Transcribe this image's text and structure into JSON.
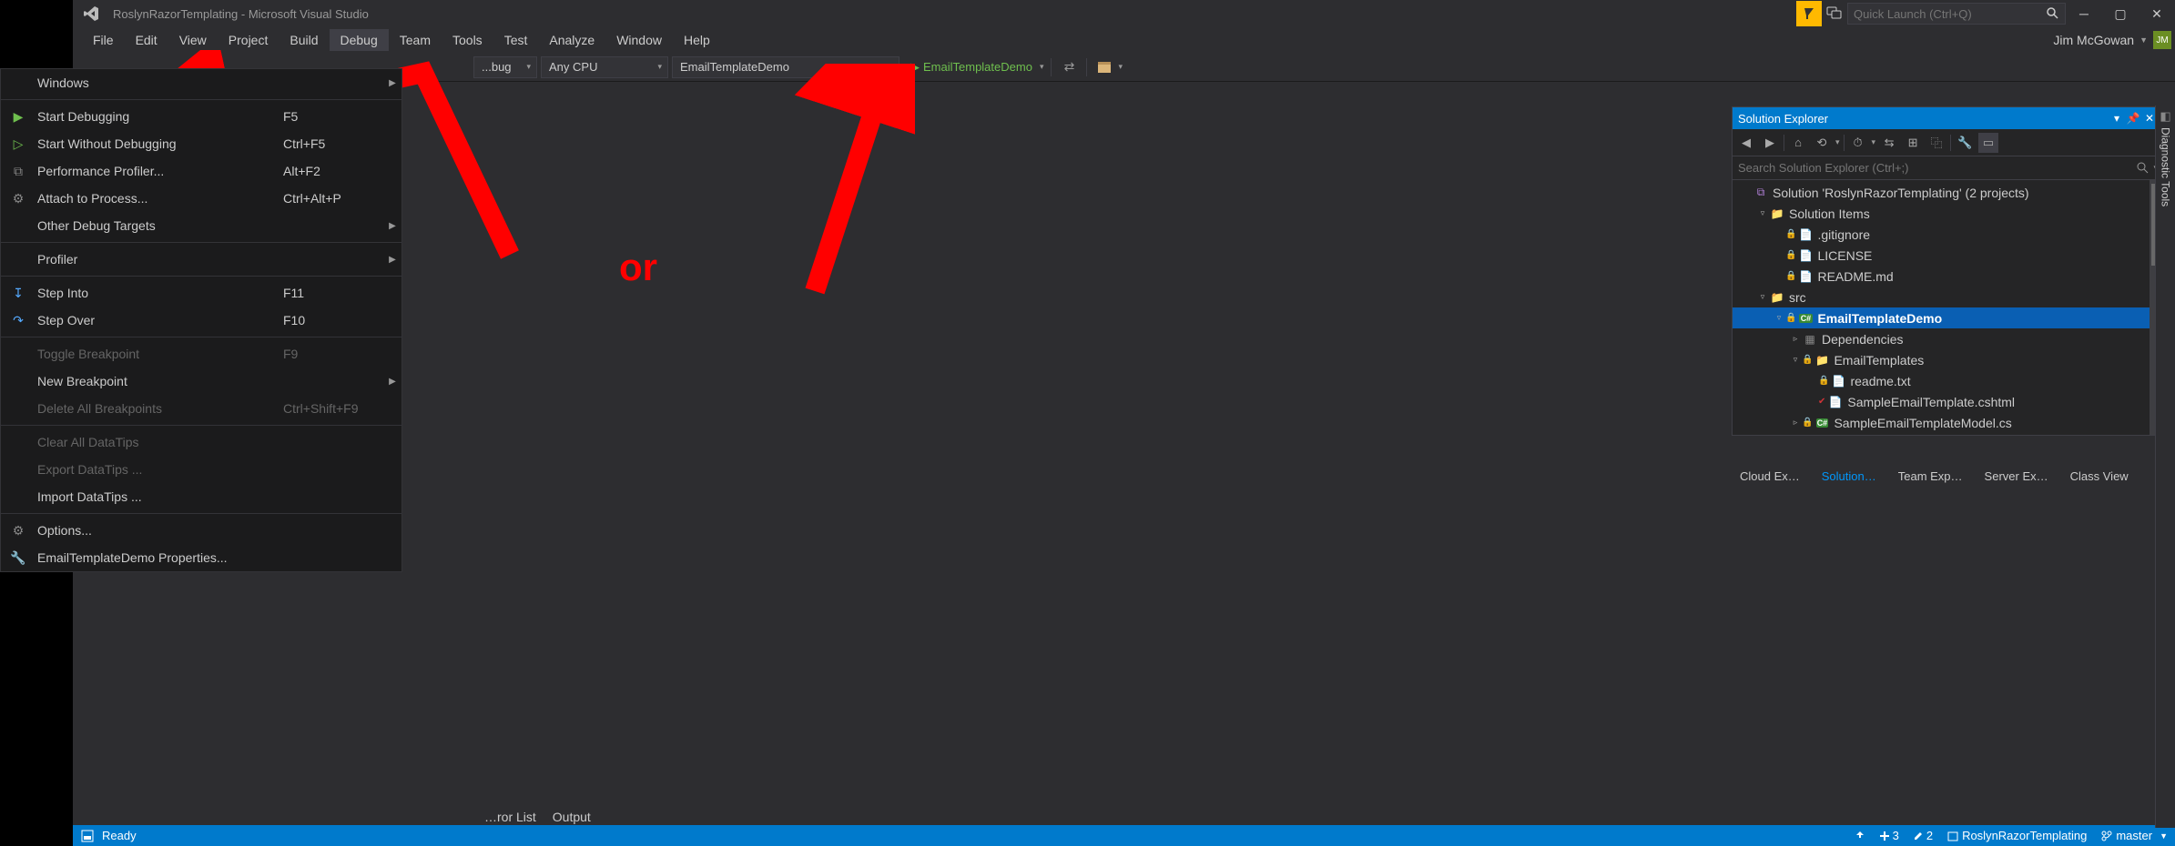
{
  "titlebar": {
    "title": "RoslynRazorTemplating - Microsoft Visual Studio",
    "quick_launch_placeholder": "Quick Launch (Ctrl+Q)"
  },
  "menubar": {
    "items": [
      "File",
      "Edit",
      "View",
      "Project",
      "Build",
      "Debug",
      "Team",
      "Tools",
      "Test",
      "Analyze",
      "Window",
      "Help"
    ],
    "active_index": 5,
    "user_name": "Jim McGowan",
    "user_initials": "JM"
  },
  "toolbar": {
    "config_label": "...bug",
    "platform_label": "Any CPU",
    "startup_label": "EmailTemplateDemo",
    "play_label": "EmailTemplateDemo"
  },
  "debug_menu": {
    "items": [
      {
        "icon": "",
        "label": "Windows",
        "shortcut": "",
        "arrow": true
      },
      {
        "sep": true
      },
      {
        "icon": "▶",
        "iconColor": "#6fbf4e",
        "label": "Start Debugging",
        "shortcut": "F5"
      },
      {
        "icon": "▷",
        "iconColor": "#6fbf4e",
        "label": "Start Without Debugging",
        "shortcut": "Ctrl+F5"
      },
      {
        "icon": "⧉",
        "iconColor": "#888",
        "label": "Performance Profiler...",
        "shortcut": "Alt+F2"
      },
      {
        "icon": "⚙",
        "iconColor": "#888",
        "label": "Attach to Process...",
        "shortcut": "Ctrl+Alt+P"
      },
      {
        "icon": "",
        "label": "Other Debug Targets",
        "arrow": true
      },
      {
        "sep": true
      },
      {
        "icon": "",
        "label": "Profiler",
        "arrow": true
      },
      {
        "sep": true
      },
      {
        "icon": "↧",
        "iconColor": "#55aaff",
        "label": "Step Into",
        "shortcut": "F11"
      },
      {
        "icon": "↷",
        "iconColor": "#55aaff",
        "label": "Step Over",
        "shortcut": "F10"
      },
      {
        "sep": true
      },
      {
        "icon": "",
        "label": "Toggle Breakpoint",
        "shortcut": "F9",
        "disabled": true
      },
      {
        "icon": "",
        "label": "New Breakpoint",
        "arrow": true
      },
      {
        "icon": "",
        "label": "Delete All Breakpoints",
        "shortcut": "Ctrl+Shift+F9",
        "disabled": true
      },
      {
        "sep": true
      },
      {
        "icon": "",
        "label": "Clear All DataTips",
        "disabled": true
      },
      {
        "icon": "",
        "label": "Export DataTips ...",
        "disabled": true
      },
      {
        "icon": "",
        "label": "Import DataTips ..."
      },
      {
        "sep": true
      },
      {
        "icon": "⚙",
        "iconColor": "#888",
        "label": "Options..."
      },
      {
        "icon": "🔧",
        "iconColor": "#888",
        "label": "EmailTemplateDemo Properties..."
      }
    ]
  },
  "solution_explorer": {
    "title": "Solution Explorer",
    "search_placeholder": "Search Solution Explorer (Ctrl+;)",
    "tree": [
      {
        "depth": 0,
        "exp": "",
        "icon": "sln",
        "label": "Solution 'RoslynRazorTemplating' (2 projects)"
      },
      {
        "depth": 1,
        "exp": "▿",
        "icon": "folder",
        "label": "Solution Items"
      },
      {
        "depth": 2,
        "exp": "",
        "icon": "file",
        "lock": true,
        "label": ".gitignore"
      },
      {
        "depth": 2,
        "exp": "",
        "icon": "file",
        "lock": true,
        "label": "LICENSE"
      },
      {
        "depth": 2,
        "exp": "",
        "icon": "file",
        "lock": true,
        "label": "README.md"
      },
      {
        "depth": 1,
        "exp": "▿",
        "icon": "folder",
        "label": "src"
      },
      {
        "depth": 2,
        "exp": "▿",
        "icon": "prj",
        "lock": true,
        "label": "EmailTemplateDemo",
        "sel": true,
        "bold": true
      },
      {
        "depth": 3,
        "exp": "▹",
        "icon": "dep",
        "label": "Dependencies"
      },
      {
        "depth": 3,
        "exp": "▿",
        "icon": "folder",
        "lock": true,
        "label": "EmailTemplates"
      },
      {
        "depth": 4,
        "exp": "",
        "icon": "file",
        "lock": true,
        "label": "readme.txt"
      },
      {
        "depth": 4,
        "exp": "",
        "icon": "file",
        "redcheck": true,
        "label": "SampleEmailTemplate.cshtml"
      },
      {
        "depth": 3,
        "exp": "▹",
        "icon": "cs",
        "lock": true,
        "label": "SampleEmailTemplateModel.cs"
      }
    ],
    "tabs": [
      "Cloud Ex…",
      "Solution…",
      "Team Exp…",
      "Server Ex…",
      "Class View"
    ],
    "active_tab": 1
  },
  "sidebar_right": {
    "label": "Diagnostic Tools"
  },
  "bottom_tabs": [
    "…ror List",
    "Output"
  ],
  "statusbar": {
    "ready": "Ready",
    "add_count": "3",
    "edit_count": "2",
    "repo": "RoslynRazorTemplating",
    "branch": "master"
  },
  "annotation": {
    "or_text": "or"
  }
}
